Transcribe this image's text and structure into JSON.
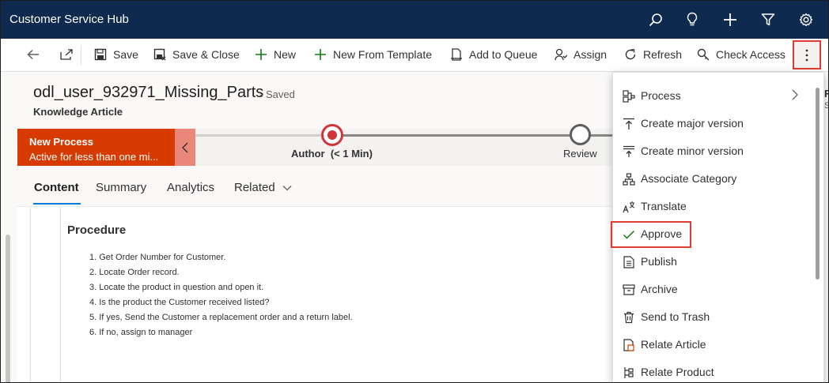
{
  "app": {
    "title": "Customer Service Hub"
  },
  "topbar": {
    "icons": [
      "search-icon",
      "lightbulb-icon",
      "plus-icon",
      "filter-icon",
      "settings-icon"
    ]
  },
  "commandbar": {
    "save": "Save",
    "save_close": "Save & Close",
    "new": "New",
    "new_from_template": "New From Template",
    "add_to_queue": "Add to Queue",
    "assign": "Assign",
    "refresh": "Refresh",
    "check_access": "Check Access"
  },
  "record": {
    "title": "odl_user_932971_Missing_Parts",
    "saved_status": "- Saved",
    "entity": "Knowledge Article"
  },
  "process": {
    "name": "New Process",
    "duration": "Active for less than one mi...",
    "stages": [
      {
        "label": "Author",
        "time": "(< 1 Min)",
        "active": true
      },
      {
        "label": "Review",
        "active": false
      }
    ]
  },
  "tabs": [
    {
      "label": "Content",
      "active": true
    },
    {
      "label": "Summary"
    },
    {
      "label": "Analytics"
    },
    {
      "label": "Related"
    }
  ],
  "content": {
    "heading": "Procedure",
    "steps": [
      "1. Get Order Number for Customer.",
      "2. Locate Order record.",
      "3. Locate the product in question and open it.",
      "4. Is the product the Customer received listed?",
      "5. If yes, Send the Customer a replacement order and a return label.",
      "6. If no, assign to manager"
    ]
  },
  "right_pane": {
    "letter": "F",
    "sub": "S"
  },
  "menu": {
    "items": [
      {
        "label": "Process",
        "icon": "process-icon",
        "submenu": true
      },
      {
        "label": "Create major version",
        "icon": "version-major-icon"
      },
      {
        "label": "Create minor version",
        "icon": "version-minor-icon"
      },
      {
        "label": "Associate Category",
        "icon": "category-icon"
      },
      {
        "label": "Translate",
        "icon": "translate-icon"
      },
      {
        "label": "Approve",
        "icon": "checkmark-icon",
        "highlighted": true
      },
      {
        "label": "Publish",
        "icon": "publish-icon"
      },
      {
        "label": "Archive",
        "icon": "archive-icon"
      },
      {
        "label": "Send to Trash",
        "icon": "trash-icon"
      },
      {
        "label": "Relate Article",
        "icon": "relate-article-icon"
      },
      {
        "label": "Relate Product",
        "icon": "relate-product-icon"
      }
    ]
  },
  "colors": {
    "topbar": "#0e2a4f",
    "process_active": "#d83b01",
    "highlight": "#e03c31",
    "tab_underline": "#0078d4"
  }
}
